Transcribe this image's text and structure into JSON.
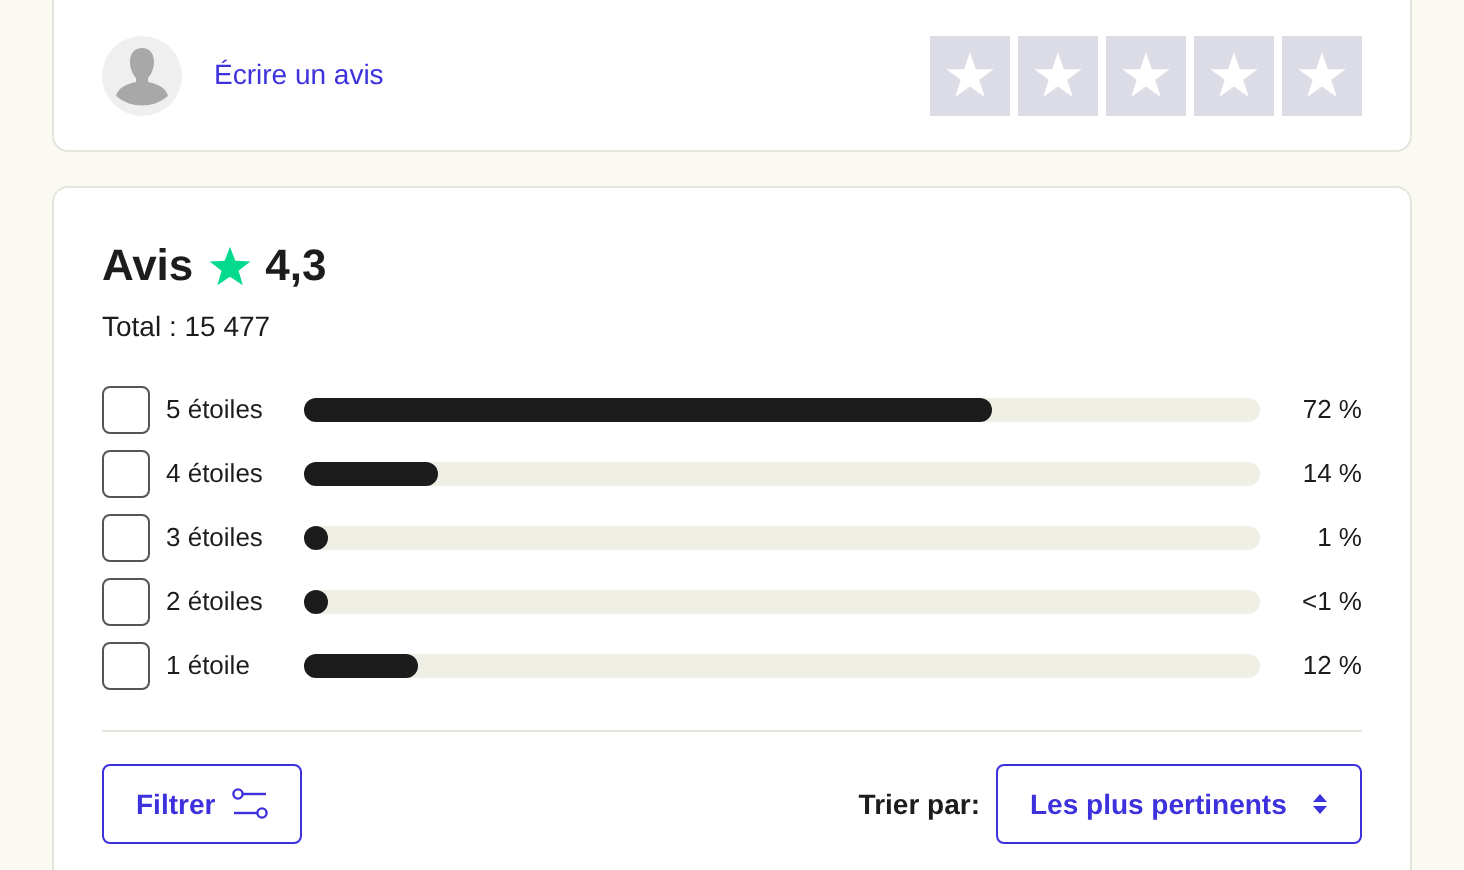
{
  "write_review": {
    "link": "Écrire un avis",
    "stars": 0
  },
  "summary": {
    "title": "Avis",
    "rating": "4,3",
    "total": "Total : 15 477"
  },
  "distribution": [
    {
      "label": "5 étoiles",
      "checked": false,
      "level": 0.72,
      "percent": "72 %"
    },
    {
      "label": "4 étoiles",
      "checked": false,
      "level": 0.14,
      "percent": "14 %"
    },
    {
      "label": "3 étoiles",
      "checked": false,
      "level": 0.01,
      "percent": "1 %"
    },
    {
      "label": "2 étoiles",
      "checked": false,
      "level": 0.004,
      "percent": "<1 %"
    },
    {
      "label": "1 étoile",
      "checked": false,
      "level": 0.12,
      "percent": "12 %"
    }
  ],
  "filter_button": "Filtrer",
  "sort": {
    "label": "Trier par:",
    "value": "Les plus pertinents"
  }
}
